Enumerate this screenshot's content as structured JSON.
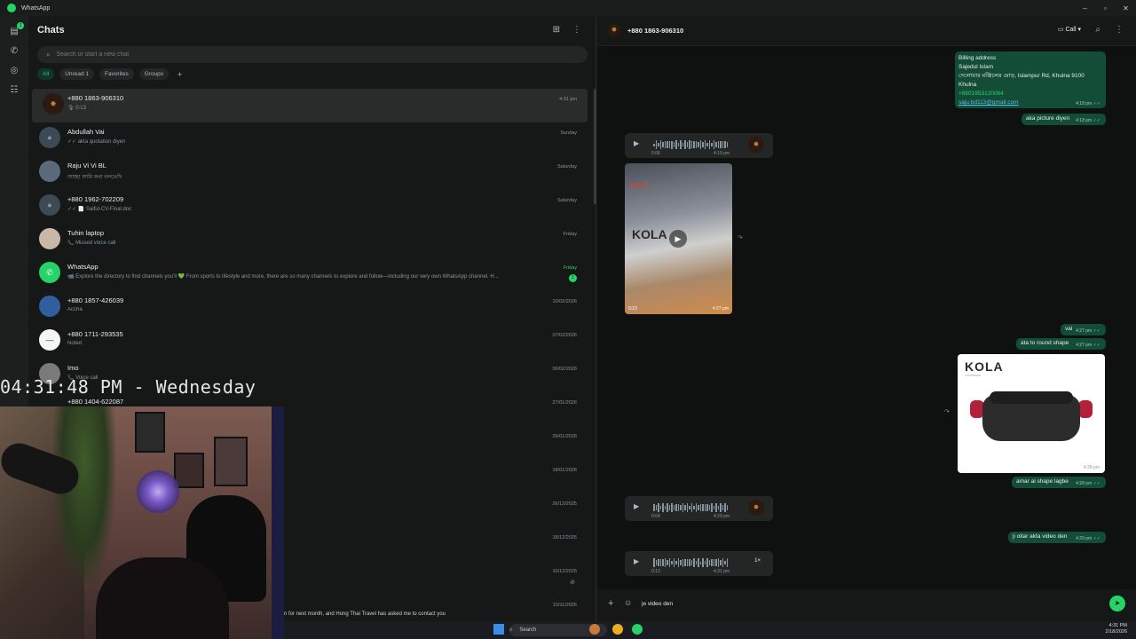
{
  "window": {
    "title": "WhatsApp"
  },
  "sidebar": {
    "unread_badge": "1"
  },
  "chatlist": {
    "title": "Chats",
    "search_placeholder": "Search or start a new chat",
    "filters": [
      "All",
      "Unread 1",
      "Favorites",
      "Groups"
    ],
    "rows": [
      {
        "name": "+880 1863-906310",
        "preview": "🎙 0:13",
        "time": "4:31 pm"
      },
      {
        "name": "Abdullah Vai",
        "preview": "✓✓ akta quotation diyen",
        "time": "Sunday"
      },
      {
        "name": "Raju Vi Vi BL",
        "preview": "আচ্ছা আমি কথা বলতেছি",
        "time": "Saturday"
      },
      {
        "name": "+880 1962-702209",
        "preview": "✓✓ 📄 Saiful-CV-Final.doc",
        "time": "Saturday"
      },
      {
        "name": "Tuhin laptop",
        "preview": "📞 Missed voice call",
        "time": "Friday"
      },
      {
        "name": "WhatsApp",
        "preview": "📹 Explore the directory to find channels you'll 💚 From sports to lifestyle and more, there are so many channels to explore and follow—including our very own WhatsApp channel. H...",
        "time": "Friday",
        "unread": "1"
      },
      {
        "name": "+880 1857-426039",
        "preview": "Accha",
        "time": "10/02/2026"
      },
      {
        "name": "+880 1711-293535",
        "preview": "Noted",
        "time": "07/02/2026"
      },
      {
        "name": "Imo",
        "preview": "📞 Voice call",
        "time": "06/02/2026"
      },
      {
        "name": "+880 1404-622087",
        "preview": "",
        "time": "27/01/2026"
      },
      {
        "name": "",
        "preview": "",
        "time": "26/01/2026"
      },
      {
        "name": "",
        "preview": "",
        "time": "18/01/2026"
      },
      {
        "name": "",
        "preview": "",
        "time": "26/12/2025"
      },
      {
        "name": "",
        "preview": "",
        "time": "18/12/2025"
      },
      {
        "name": "",
        "preview": "",
        "time": "10/12/2025"
      },
      {
        "name": "",
        "preview": "",
        "time": "10/11/2025"
      }
    ],
    "bottom_snippet": "n for next month, and Hong Thai Travel has asked me to contact you"
  },
  "overlay": {
    "clock": "04:31:48 PM - Wednesday"
  },
  "conversation": {
    "contact": "+880 1863-906310",
    "call_label": "Call",
    "billing": {
      "lines": [
        "Billing address",
        "Sajedul Islam",
        "দেলোয়ার মঞ্জিলের মোড়, Islampur Rd, Khulna 9100",
        "Khulna"
      ],
      "phone": "+8801953120084",
      "email": "saju.bd113@gmail.com",
      "time": "4:18 pm"
    },
    "messages": [
      {
        "text": "aka picture diyen",
        "time": "4:18 pm"
      },
      {
        "text": "vai",
        "time": "4:27 pm"
      },
      {
        "text": "ata to round shape",
        "time": "4:27 pm"
      },
      {
        "text": "amar ai shape lagbe",
        "time": "4:28 pm"
      },
      {
        "text": "ji oitar akta video den",
        "time": "4:29 pm"
      }
    ],
    "voice1": {
      "dur": "0:06",
      "time": "4:19 pm"
    },
    "video": {
      "length": "0:23",
      "time": "4:27 pm",
      "brand": "KOLO",
      "logo": "KOLA"
    },
    "product": {
      "logo": "KOLA",
      "sub": "COOKWARE",
      "time": "4:28 pm"
    },
    "voice2": {
      "dur": "0:04",
      "time": "4:29 pm"
    },
    "voice3": {
      "dur": "0:13",
      "time": "4:31 pm",
      "speed": "1×"
    },
    "composer_value": "je video den"
  },
  "taskbar": {
    "search": "Search",
    "time": "4:31 PM",
    "date": "2/18/2026"
  },
  "colors": {
    "accent": "#25d366",
    "outgoing": "#144d37",
    "incoming": "#242626"
  }
}
